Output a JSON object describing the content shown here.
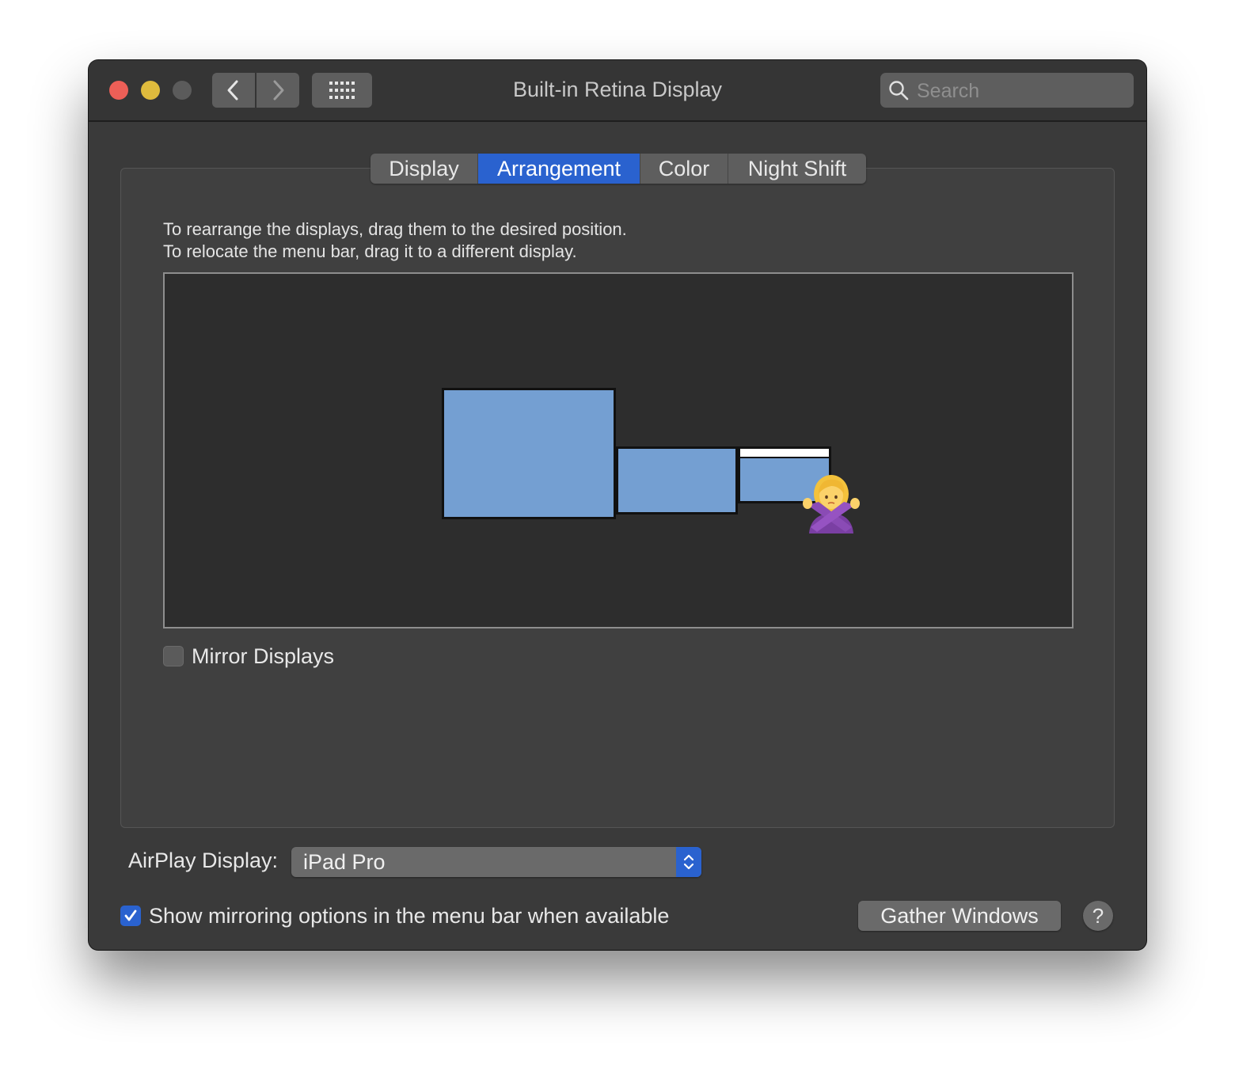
{
  "window": {
    "title": "Built-in Retina Display"
  },
  "toolbar": {
    "back_icon": "chevron-left-icon",
    "forward_icon": "chevron-right-icon",
    "grid_icon": "grid-icon"
  },
  "search": {
    "placeholder": "Search",
    "icon": "search-icon"
  },
  "tabs": [
    {
      "label": "Display",
      "selected": false
    },
    {
      "label": "Arrangement",
      "selected": true
    },
    {
      "label": "Color",
      "selected": false
    },
    {
      "label": "Night Shift",
      "selected": false
    }
  ],
  "arrangement": {
    "instruction_line1": "To rearrange the displays, drag them to the desired position.",
    "instruction_line2": "To relocate the menu bar, drag it to a different display.",
    "displays": [
      {
        "id": "display-1",
        "has_menu_bar": false
      },
      {
        "id": "display-2",
        "has_menu_bar": false
      },
      {
        "id": "display-3",
        "has_menu_bar": true
      }
    ],
    "emoji": "woman-gesturing-no-emoji"
  },
  "mirror": {
    "label": "Mirror Displays",
    "checked": false
  },
  "airplay": {
    "label": "AirPlay Display:",
    "value": "iPad Pro"
  },
  "show_mirroring": {
    "label": "Show mirroring options in the menu bar when available",
    "checked": true
  },
  "buttons": {
    "gather": "Gather Windows",
    "help": "?"
  },
  "colors": {
    "accent": "#2a62cf",
    "display_fill": "#749fd2",
    "close": "#ed5f57",
    "minimize": "#dfbb3d",
    "zoom_disabled": "#5b5b5b"
  }
}
